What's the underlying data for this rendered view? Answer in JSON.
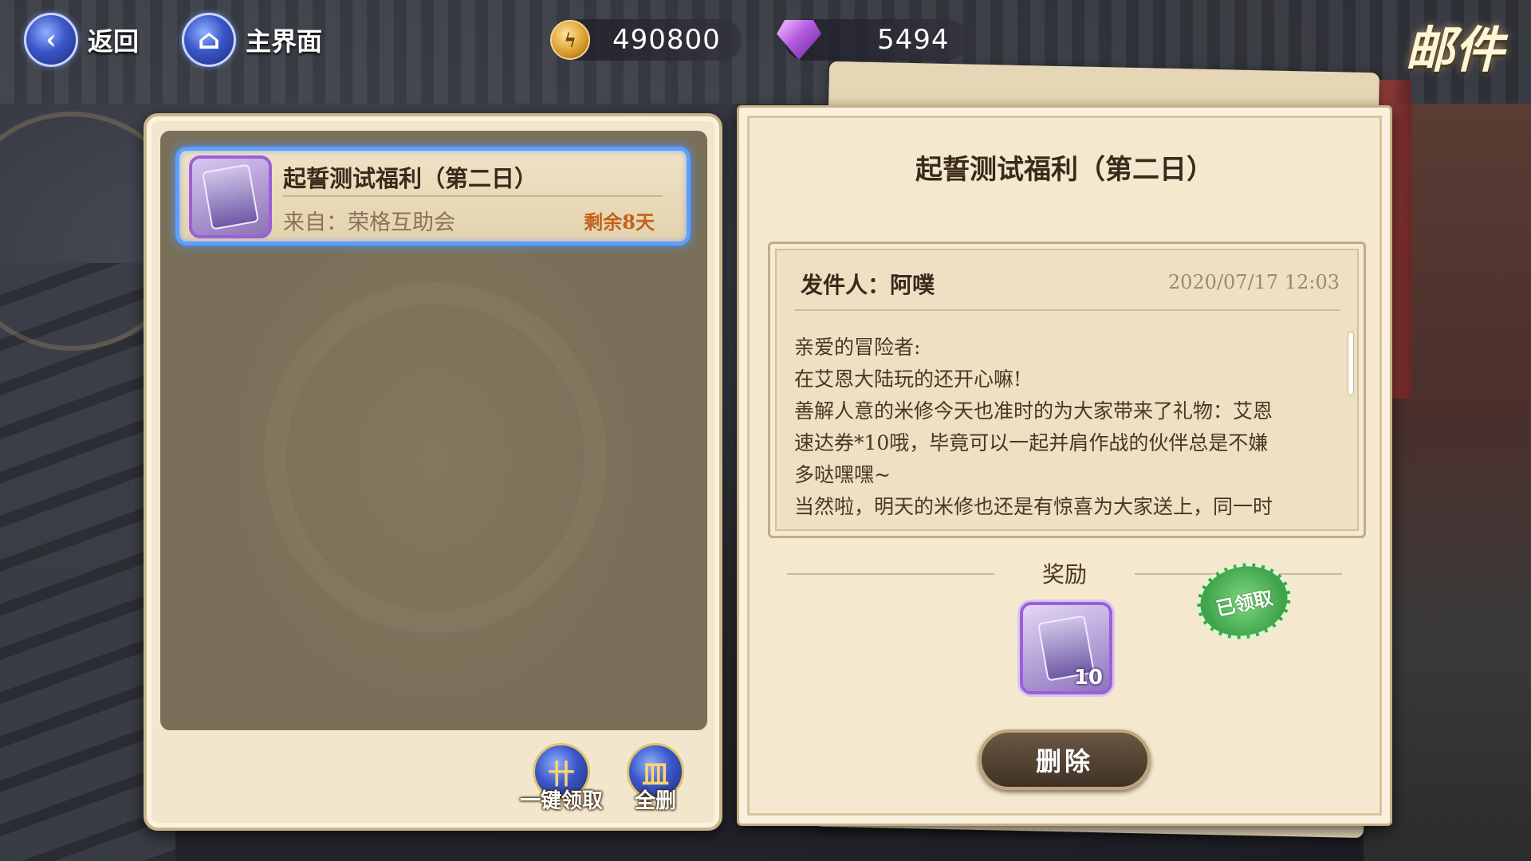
{
  "topbar": {
    "back_label": "返回",
    "home_label": "主界面",
    "gold_amount": "490800",
    "gem_amount": "5494",
    "page_title": "邮件"
  },
  "mail_list": {
    "items": [
      {
        "title": "起誓测试福利（第二日）",
        "from": "来自：荣格互助会",
        "remaining": "剩余8天",
        "selected": true
      }
    ],
    "claim_all_label": "一键领取",
    "delete_all_label": "全删"
  },
  "mail_detail": {
    "title": "起誓测试福利（第二日）",
    "sender": "发件人：阿噗",
    "sent_time": "2020/07/17 12:03",
    "body_lines": [
      "亲爱的冒险者:",
      "在艾恩大陆玩的还开心嘛!",
      "善解人意的米修今天也准时的为大家带来了礼物：艾恩",
      "速达券*10哦，毕竟可以一起并肩作战的伙伴总是不嫌",
      "多哒嘿嘿~",
      "当然啦，明天的米修也还是有惊喜为大家送上，同一时"
    ],
    "reward_label": "奖励",
    "reward_quantity": "10",
    "claimed_stamp": "已领取",
    "delete_label": "删除"
  },
  "colors": {
    "selection_glow": "#5aa0ff",
    "remaining_text": "#c2621c",
    "stamp_green": "#3fa34a"
  }
}
